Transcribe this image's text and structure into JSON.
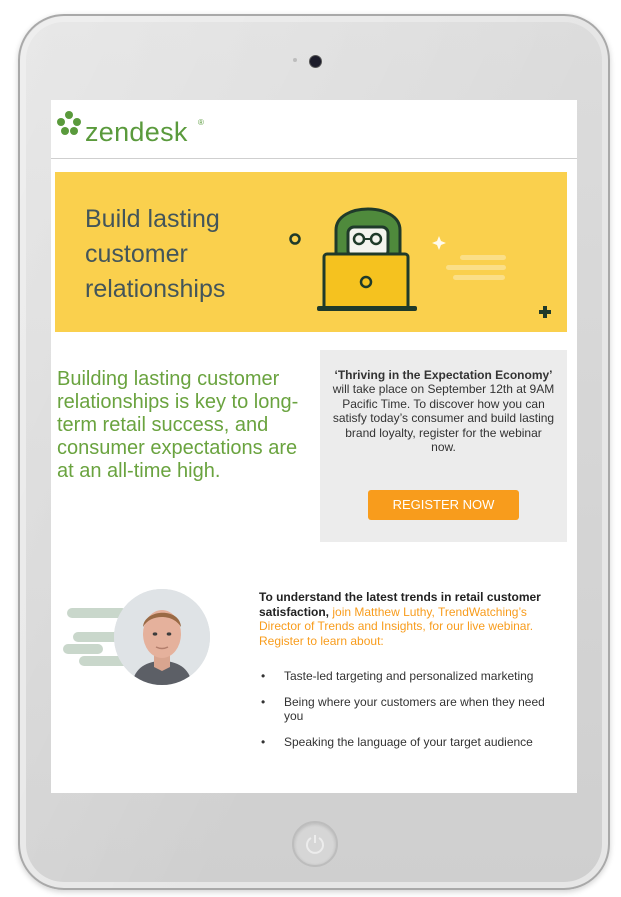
{
  "header": {
    "logo_text": "zendesk",
    "logo_trademark": "®"
  },
  "banner": {
    "title": "Build lasting\ncustomer\nrelationships",
    "background_color": "#fad04d"
  },
  "lead": {
    "text": "Building lasting customer relationships is key to long-term retail success, and consumer expectations are at an all-time high.",
    "color": "#6aa33f"
  },
  "promo": {
    "title_bold": "‘Thriving in the Expectation Economy’",
    "body": " will take place on September 12th at 9AM Pacific Time. To discover how you can satisfy today’s consumer and build lasting brand loyalty, register for the webinar now.",
    "button_label": "REGISTER NOW",
    "button_color": "#f89c1c"
  },
  "speaker": {
    "intro_bold": "To understand the latest trends in retail customer satisfaction,",
    "intro_orange": " join Matthew Luthy, TrendWatching’s Director of Trends and Insights, for our live webinar. Register to learn about:",
    "topics": [
      "Taste-led targeting and personalized marketing",
      "Being where your customers are when they need you",
      "Speaking the language of your target audience"
    ]
  },
  "device": {
    "camera_icon": "camera-icon",
    "home_icon": "power-icon"
  }
}
